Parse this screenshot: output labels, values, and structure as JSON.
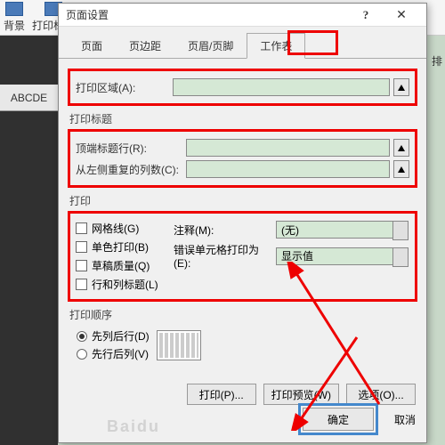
{
  "ribbon": {
    "bg": "背景",
    "titles": "打印标题"
  },
  "sheet": {
    "cols": "ABCDE"
  },
  "right": {
    "sort": "排"
  },
  "dialog": {
    "title": "页面设置",
    "tabs": {
      "page": "页面",
      "margins": "页边距",
      "header": "页眉/页脚",
      "sheet": "工作表"
    },
    "print_area": {
      "label": "打印区域(A):"
    },
    "titles_section": "打印标题",
    "titles": {
      "rows": "顶端标题行(R):",
      "cols": "从左侧重复的列数(C):"
    },
    "print_section": "打印",
    "options": {
      "grid": "网格线(G)",
      "bw": "单色打印(B)",
      "draft": "草稿质量(Q)",
      "rowcol": "行和列标题(L)"
    },
    "comments": {
      "label": "注释(M):",
      "value": "(无)"
    },
    "errors": {
      "label": "错误单元格打印为(E):",
      "value": "显示值"
    },
    "order_section": "打印顺序",
    "order": {
      "down": "先列后行(D)",
      "over": "先行后列(V)"
    },
    "buttons": {
      "print": "打印(P)...",
      "preview": "打印预览(W)",
      "options": "选项(O)...",
      "ok": "确定",
      "cancel": "取消"
    }
  },
  "watermark": "Baidu"
}
